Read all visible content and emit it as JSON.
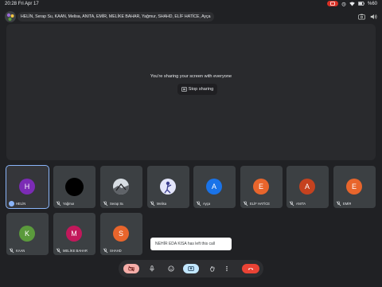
{
  "status": {
    "time": "20:28",
    "date": "Fri Apr 17",
    "battery": "%60"
  },
  "meeting": {
    "participants_label": "HELİN, Serap Su, KAAN, Melisa, ANITA, EMİR, MELİKE BAHAR, Yağmur, SHAHD, ELİF HATİCE, Ayça"
  },
  "screen_share": {
    "message": "You're sharing your screen with everyone",
    "stop_label": "Stop sharing"
  },
  "tiles": [
    {
      "name": "HELİN",
      "initial": "H",
      "color": "#7b2bb5"
    },
    {
      "name": "Yağmur",
      "initial": "",
      "color": "#000000"
    },
    {
      "name": "Serap Su",
      "initial": "",
      "color": "#9aa0a6"
    },
    {
      "name": "Melisa",
      "initial": "",
      "color": "#d7d9f7"
    },
    {
      "name": "Ayça",
      "initial": "A",
      "color": "#1a73e8"
    },
    {
      "name": "ELİF HATİCE",
      "initial": "E",
      "color": "#e8652c"
    },
    {
      "name": "ANITA",
      "initial": "A",
      "color": "#c5421f"
    },
    {
      "name": "EMİR",
      "initial": "E",
      "color": "#e8652c"
    },
    {
      "name": "KAAN",
      "initial": "K",
      "color": "#5b9a3c"
    },
    {
      "name": "MELİKE BAHAR",
      "initial": "M",
      "color": "#c2185b"
    },
    {
      "name": "SHAHD",
      "initial": "S",
      "color": "#e8652c"
    }
  ],
  "toast": {
    "message": "NEHİR EDA KISA has left this call"
  },
  "controls": {
    "camera_off_color": "#f6aea9",
    "present_active_color": "#c2e7ff",
    "end_call_color": "#ea4335"
  }
}
